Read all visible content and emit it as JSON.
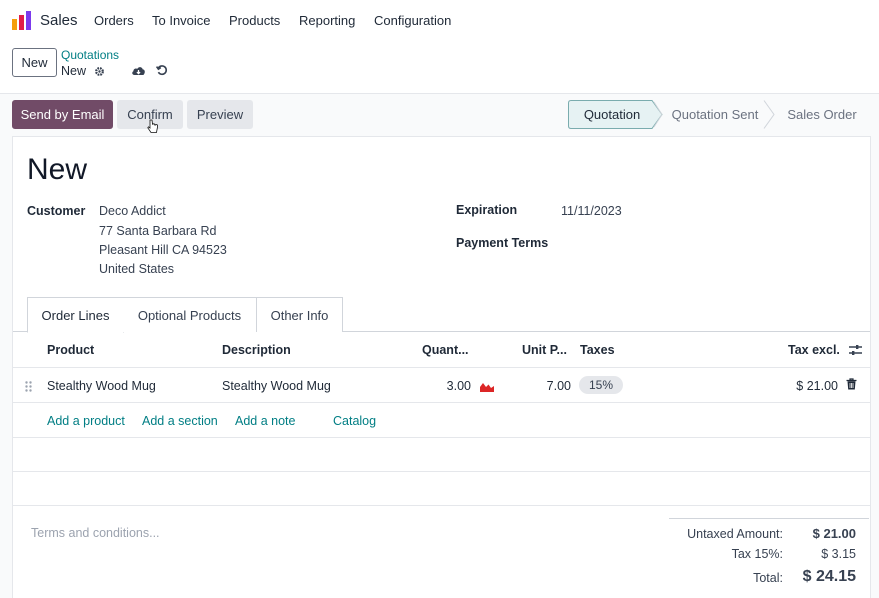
{
  "nav": {
    "app_name": "Sales",
    "menu": [
      "Orders",
      "To Invoice",
      "Products",
      "Reporting",
      "Configuration"
    ]
  },
  "control_panel": {
    "new_button": "New",
    "breadcrumb_parent": "Quotations",
    "breadcrumb_current": "New"
  },
  "actions": {
    "send_email": "Send by Email",
    "confirm": "Confirm",
    "preview": "Preview"
  },
  "statusbar": {
    "stages": [
      "Quotation",
      "Quotation Sent",
      "Sales Order"
    ],
    "active": "Quotation"
  },
  "form": {
    "title": "New",
    "customer_label": "Customer",
    "customer": {
      "name": "Deco Addict",
      "street": "77 Santa Barbara Rd",
      "city": "Pleasant Hill CA 94523",
      "country": "United States"
    },
    "expiration_label": "Expiration",
    "expiration": "11/11/2023",
    "payment_terms_label": "Payment Terms"
  },
  "tabs": [
    "Order Lines",
    "Optional Products",
    "Other Info"
  ],
  "order_lines": {
    "columns": [
      "Product",
      "Description",
      "Quant...",
      "Unit P...",
      "Taxes",
      "Tax excl."
    ],
    "rows": [
      {
        "product": "Stealthy Wood Mug",
        "description": "Stealthy Wood Mug",
        "quantity": "3.00",
        "unit_price": "7.00",
        "taxes": "15%",
        "subtotal": "$ 21.00"
      }
    ],
    "add_links": [
      "Add a product",
      "Add a section",
      "Add a note",
      "Catalog"
    ]
  },
  "terms_placeholder": "Terms and conditions...",
  "totals": {
    "untaxed_label": "Untaxed Amount:",
    "untaxed": "$ 21.00",
    "tax_label": "Tax 15%:",
    "tax": "$ 3.15",
    "total_label": "Total:",
    "total": "$ 24.15"
  },
  "colors": {
    "primary": "#714b67",
    "link": "#017e84",
    "status_active_bg": "#e6f2f3"
  }
}
